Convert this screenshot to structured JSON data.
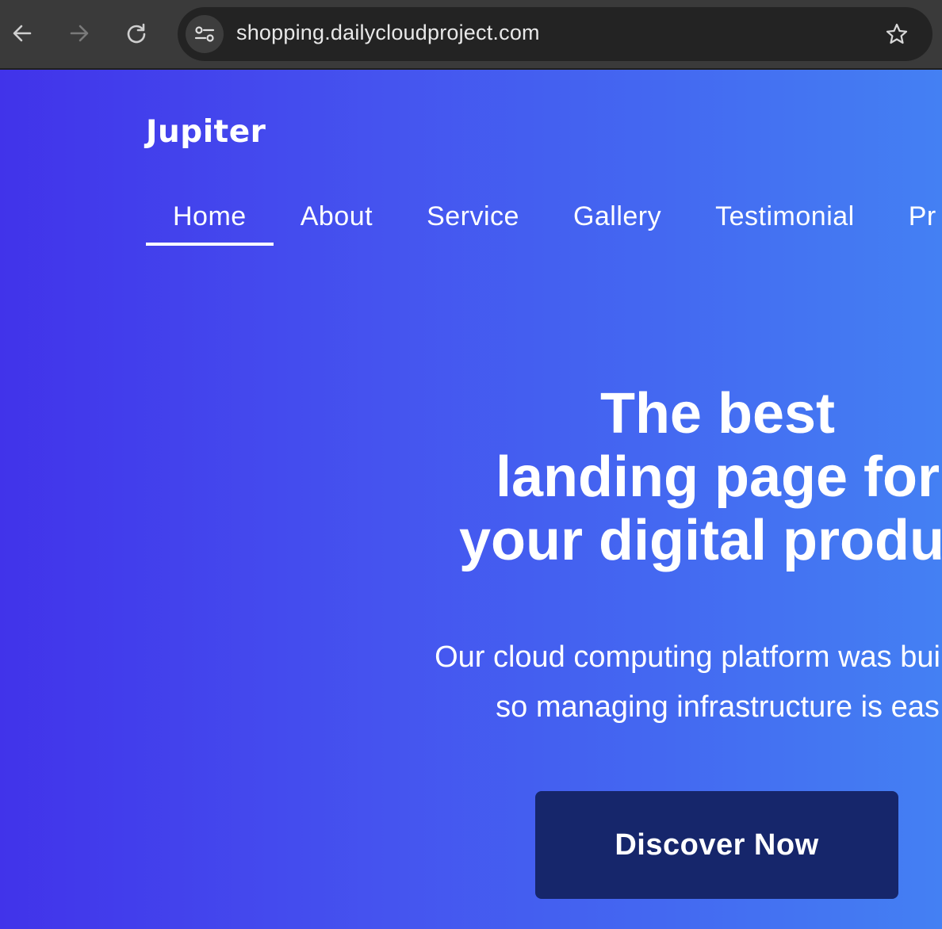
{
  "browser": {
    "url": "shopping.dailycloudproject.com",
    "icons": [
      "back-arrow-icon",
      "forward-arrow-icon",
      "reload-icon",
      "site-info-icon",
      "bookmark-star-icon"
    ]
  },
  "site": {
    "brand": "Jupiter",
    "nav": [
      {
        "label": "Home",
        "active": true
      },
      {
        "label": "About"
      },
      {
        "label": "Service"
      },
      {
        "label": "Gallery"
      },
      {
        "label": "Testimonial"
      },
      {
        "label": "Pr"
      }
    ],
    "hero": {
      "title_lines": [
        "The best",
        "landing page for",
        "your digital produc"
      ],
      "subtitle_lines": [
        "Our cloud computing platform was built wit",
        "so managing infrastructure is eas"
      ],
      "cta_label": "Discover Now"
    },
    "colors": {
      "gradient_start": "#4133ea",
      "gradient_end": "#4480f3",
      "cta_background": "#16266b"
    }
  }
}
